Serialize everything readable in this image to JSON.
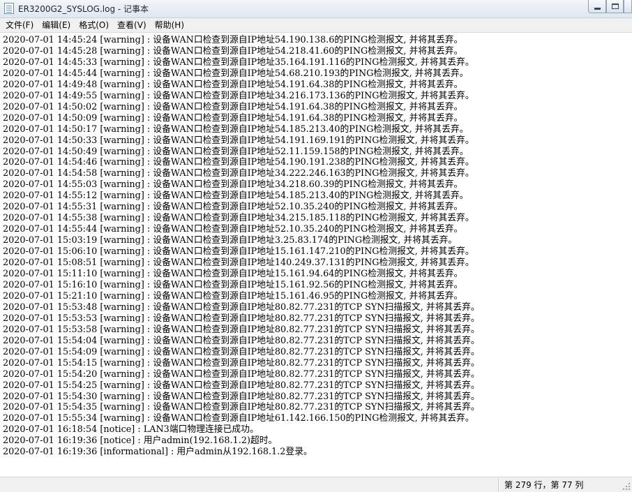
{
  "window": {
    "title": "ER3200G2_SYSLOG.log - 记事本"
  },
  "menu": {
    "items": [
      "文件(F)",
      "编辑(E)",
      "格式(O)",
      "查看(V)",
      "帮助(H)"
    ]
  },
  "editor": {
    "lines": [
      "2020-07-01 14:45:24 [warning] : 设备WAN口检查到源自IP地址54.190.138.6的PING检测报文, 并将其丢弃。",
      "2020-07-01 14:45:28 [warning] : 设备WAN口检查到源自IP地址54.218.41.60的PING检测报文, 并将其丢弃。",
      "2020-07-01 14:45:33 [warning] : 设备WAN口检查到源自IP地址35.164.191.116的PING检测报文, 并将其丢弃。",
      "2020-07-01 14:45:44 [warning] : 设备WAN口检查到源自IP地址54.68.210.193的PING检测报文, 并将其丢弃。",
      "2020-07-01 14:49:48 [warning] : 设备WAN口检查到源自IP地址54.191.64.38的PING检测报文, 并将其丢弃。",
      "2020-07-01 14:49:55 [warning] : 设备WAN口检查到源自IP地址34.216.173.136的PING检测报文, 并将其丢弃。",
      "2020-07-01 14:50:02 [warning] : 设备WAN口检查到源自IP地址54.191.64.38的PING检测报文, 并将其丢弃。",
      "2020-07-01 14:50:09 [warning] : 设备WAN口检查到源自IP地址54.191.64.38的PING检测报文, 并将其丢弃。",
      "2020-07-01 14:50:17 [warning] : 设备WAN口检查到源自IP地址54.185.213.40的PING检测报文, 并将其丢弃。",
      "2020-07-01 14:50:33 [warning] : 设备WAN口检查到源自IP地址54.191.169.191的PING检测报文, 并将其丢弃。",
      "2020-07-01 14:50:49 [warning] : 设备WAN口检查到源自IP地址52.11.159.158的PING检测报文, 并将其丢弃。",
      "2020-07-01 14:54:46 [warning] : 设备WAN口检查到源自IP地址54.190.191.238的PING检测报文, 并将其丢弃。",
      "2020-07-01 14:54:58 [warning] : 设备WAN口检查到源自IP地址34.222.246.163的PING检测报文, 并将其丢弃。",
      "2020-07-01 14:55:03 [warning] : 设备WAN口检查到源自IP地址34.218.60.39的PING检测报文, 并将其丢弃。",
      "2020-07-01 14:55:12 [warning] : 设备WAN口检查到源自IP地址54.185.213.40的PING检测报文, 并将其丢弃。",
      "2020-07-01 14:55:31 [warning] : 设备WAN口检查到源自IP地址52.10.35.240的PING检测报文, 并将其丢弃。",
      "2020-07-01 14:55:38 [warning] : 设备WAN口检查到源自IP地址34.215.185.118的PING检测报文, 并将其丢弃。",
      "2020-07-01 14:55:44 [warning] : 设备WAN口检查到源自IP地址52.10.35.240的PING检测报文, 并将其丢弃。",
      "2020-07-01 15:03:19 [warning] : 设备WAN口检查到源自IP地址3.25.83.174的PING检测报文, 并将其丢弃。",
      "2020-07-01 15:06:10 [warning] : 设备WAN口检查到源自IP地址15.161.147.210的PING检测报文, 并将其丢弃。",
      "2020-07-01 15:08:51 [warning] : 设备WAN口检查到源自IP地址140.249.37.131的PING检测报文, 并将其丢弃。",
      "2020-07-01 15:11:10 [warning] : 设备WAN口检查到源自IP地址15.161.94.64的PING检测报文, 并将其丢弃。",
      "2020-07-01 15:16:10 [warning] : 设备WAN口检查到源自IP地址15.161.92.56的PING检测报文, 并将其丢弃。",
      "2020-07-01 15:21:10 [warning] : 设备WAN口检查到源自IP地址15.161.46.95的PING检测报文, 并将其丢弃。",
      "2020-07-01 15:53:48 [warning] : 设备WAN口检查到源自IP地址80.82.77.231的TCP SYN扫描报文, 并将其丢弃。",
      "2020-07-01 15:53:53 [warning] : 设备WAN口检查到源自IP地址80.82.77.231的TCP SYN扫描报文, 并将其丢弃。",
      "2020-07-01 15:53:58 [warning] : 设备WAN口检查到源自IP地址80.82.77.231的TCP SYN扫描报文, 并将其丢弃。",
      "2020-07-01 15:54:04 [warning] : 设备WAN口检查到源自IP地址80.82.77.231的TCP SYN扫描报文, 并将其丢弃。",
      "2020-07-01 15:54:09 [warning] : 设备WAN口检查到源自IP地址80.82.77.231的TCP SYN扫描报文, 并将其丢弃。",
      "2020-07-01 15:54:15 [warning] : 设备WAN口检查到源自IP地址80.82.77.231的TCP SYN扫描报文, 并将其丢弃。",
      "2020-07-01 15:54:20 [warning] : 设备WAN口检查到源自IP地址80.82.77.231的TCP SYN扫描报文, 并将其丢弃。",
      "2020-07-01 15:54:25 [warning] : 设备WAN口检查到源自IP地址80.82.77.231的TCP SYN扫描报文, 并将其丢弃。",
      "2020-07-01 15:54:30 [warning] : 设备WAN口检查到源自IP地址80.82.77.231的TCP SYN扫描报文, 并将其丢弃。",
      "2020-07-01 15:54:35 [warning] : 设备WAN口检查到源自IP地址80.82.77.231的TCP SYN扫描报文, 并将其丢弃。",
      "2020-07-01 15:55:34 [warning] : 设备WAN口检查到源自IP地址61.142.166.150的PING检测报文, 并将其丢弃。",
      "2020-07-01 16:18:54 [notice] : LAN3端口物理连接已成功。",
      "2020-07-01 16:19:36 [notice] : 用户admin(192.168.1.2)超时。",
      "2020-07-01 16:19:36 [informational] : 用户admin从192.168.1.2登录。"
    ]
  },
  "status": {
    "position": "第 279 行，第 77 列"
  }
}
